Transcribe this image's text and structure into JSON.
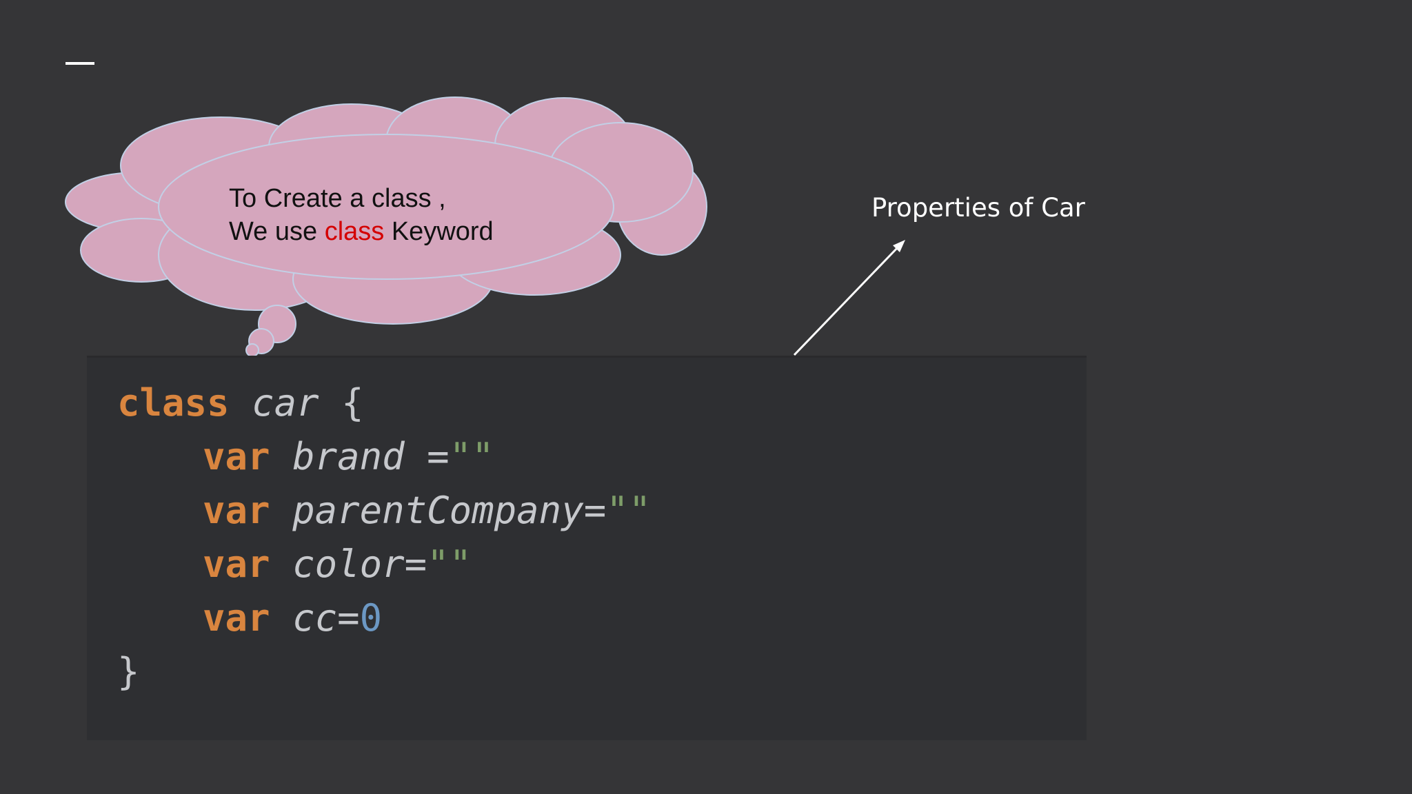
{
  "slide": {
    "cloud": {
      "line1": "To Create a class ,",
      "line2_before": "We use ",
      "line2_keyword": "class",
      "line2_after": " Keyword"
    },
    "annotation": "Properties of Car",
    "colors": {
      "background": "#353537",
      "cloud_fill": "#d5a6bd",
      "keyword_highlight": "#d40000",
      "code_background": "#2e2f32",
      "code_keyword": "#d9853f",
      "code_string": "#7e9d69",
      "code_number": "#6c98c4"
    }
  },
  "code": {
    "l1": {
      "kw": "class",
      "name": "car",
      "brace": " {"
    },
    "l2": {
      "kw": "var",
      "name": "brand",
      "op": " =",
      "str": "\"\""
    },
    "l3": {
      "kw": "var",
      "name": "parentCompany",
      "op": "=",
      "str": "\"\""
    },
    "l4": {
      "kw": "var",
      "name": "color",
      "op": "=",
      "str": "\"\""
    },
    "l5": {
      "kw": "var",
      "name": "cc",
      "op": "=",
      "num": "0"
    },
    "l6": {
      "brace": "}"
    }
  }
}
